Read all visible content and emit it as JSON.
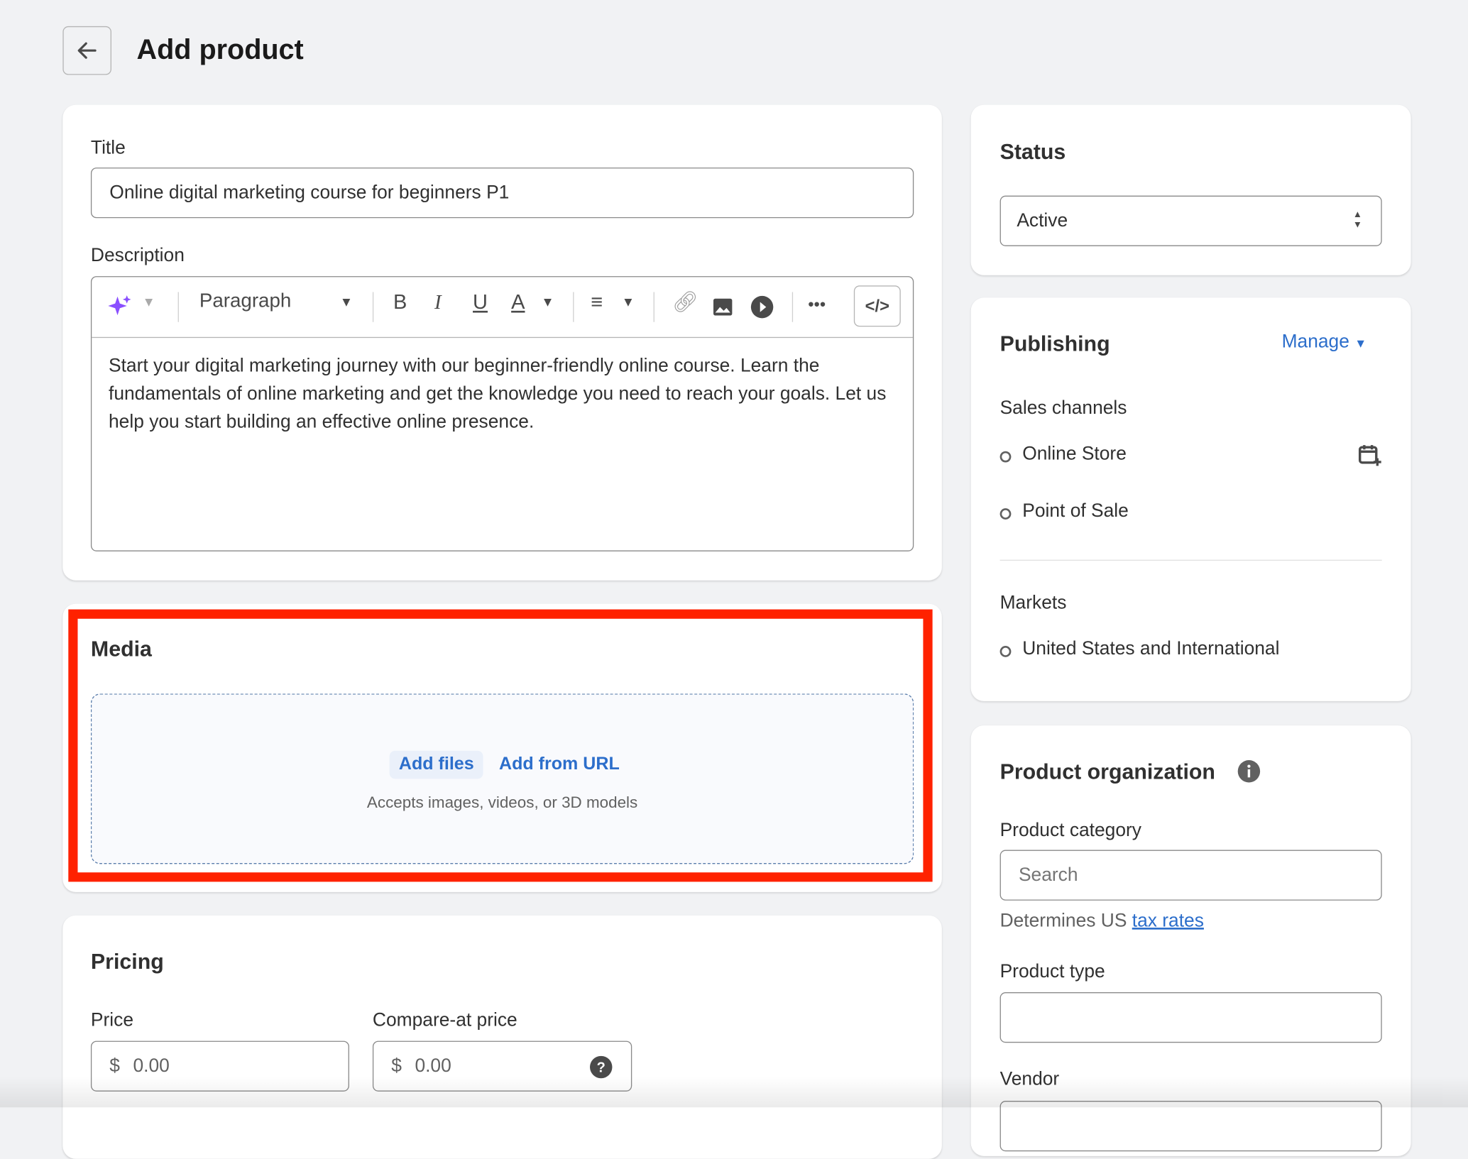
{
  "header": {
    "title": "Add product",
    "back_icon": "arrow-left-icon"
  },
  "product": {
    "title_label": "Title",
    "title_value": "Online digital marketing course for beginners P1",
    "description_label": "Description",
    "toolbar": {
      "format": "Paragraph",
      "bold": "B",
      "italic": "I",
      "underline": "U",
      "color": "A",
      "more": "•••",
      "code": "</>"
    },
    "description_text": "Start your digital marketing journey with our beginner-friendly online course. Learn the fundamentals of online marketing and get the knowledge you need to reach your goals. Let us help you start building an effective online presence."
  },
  "media": {
    "title": "Media",
    "add_files": "Add files",
    "add_url": "Add from URL",
    "hint": "Accepts images, videos, or 3D models",
    "highlight_color": "#ff2200"
  },
  "pricing": {
    "title": "Pricing",
    "price_label": "Price",
    "price_currency": "$",
    "price_placeholder": "0.00",
    "compare_label": "Compare-at price",
    "compare_currency": "$",
    "compare_placeholder": "0.00"
  },
  "status": {
    "title": "Status",
    "value": "Active"
  },
  "publishing": {
    "title": "Publishing",
    "manage": "Manage",
    "sales_channels_label": "Sales channels",
    "channels": [
      "Online Store",
      "Point of Sale"
    ],
    "markets_label": "Markets",
    "markets": [
      "United States and International"
    ]
  },
  "organization": {
    "title": "Product organization",
    "category_label": "Product category",
    "category_placeholder": "Search",
    "category_help": "Determines US ",
    "category_help_link": "tax rates",
    "type_label": "Product type",
    "type_value": "",
    "vendor_label": "Vendor"
  },
  "colors": {
    "accent": "#2c6ecb",
    "highlight": "#ff2200"
  }
}
